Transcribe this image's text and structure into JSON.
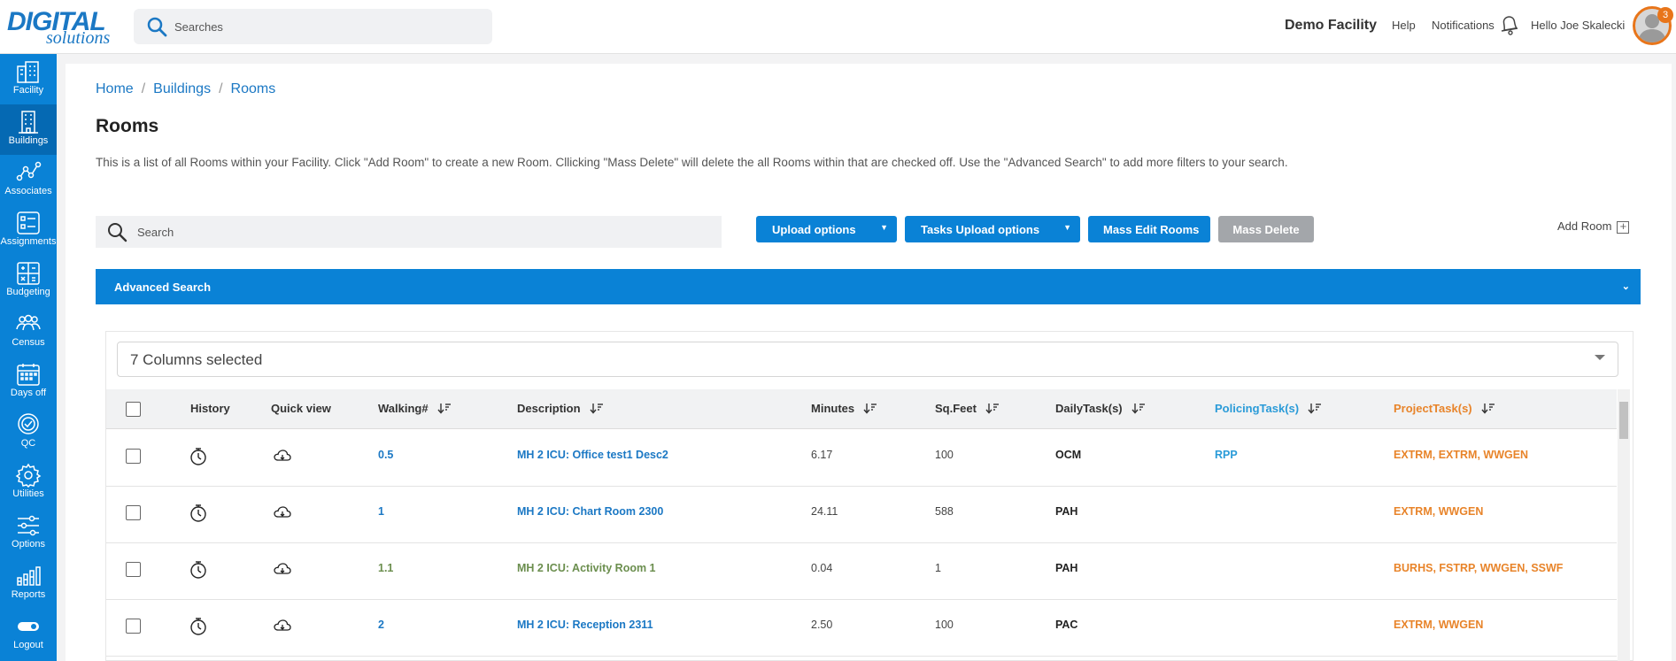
{
  "header": {
    "logo_top": "DIGITAL",
    "logo_bottom": "solutions",
    "search_placeholder": "Searches",
    "facility": "Demo Facility",
    "help": "Help",
    "notifications": "Notifications",
    "greeting": "Hello Joe Skalecki",
    "badge_count": "3"
  },
  "sidebar": {
    "items": [
      {
        "label": "Facility",
        "icon": "building-icon"
      },
      {
        "label": "Buildings",
        "icon": "office-icon"
      },
      {
        "label": "Associates",
        "icon": "network-icon"
      },
      {
        "label": "Assignments",
        "icon": "checklist-icon"
      },
      {
        "label": "Budgeting",
        "icon": "calculator-icon"
      },
      {
        "label": "Census",
        "icon": "people-icon"
      },
      {
        "label": "Days off",
        "icon": "calendar-icon"
      },
      {
        "label": "QC",
        "icon": "badge-check-icon"
      },
      {
        "label": "Utilities",
        "icon": "cog-icon"
      },
      {
        "label": "Options",
        "icon": "sliders-icon"
      },
      {
        "label": "Reports",
        "icon": "chart-icon"
      },
      {
        "label": "Logout",
        "icon": "toggle-icon"
      }
    ]
  },
  "breadcrumb": [
    "Home",
    "Buildings",
    "Rooms"
  ],
  "page": {
    "title": "Rooms",
    "description": "This is a list of all Rooms within your Facility. Click \"Add Room\" to create a new Room. Cllicking \"Mass Delete\" will delete the all Rooms within that are checked off. Use the \"Advanced Search\" to add more filters to your search."
  },
  "toolbar": {
    "search_placeholder": "Search",
    "upload_options": "Upload options",
    "tasks_upload_options": "Tasks Upload options",
    "mass_edit": "Mass Edit Rooms",
    "mass_delete": "Mass Delete",
    "add_room": "Add Room"
  },
  "advanced_search": "Advanced Search",
  "columns_selected": "7 Columns selected",
  "table": {
    "headers": {
      "history": "History",
      "quick_view": "Quick view",
      "walking": "Walking#",
      "description": "Description",
      "minutes": "Minutes",
      "sqfeet": "Sq.Feet",
      "daily": "DailyTask(s)",
      "policing": "PolicingTask(s)",
      "project": "ProjectTask(s)"
    },
    "rows": [
      {
        "walking": "0.5",
        "description": "MH 2 ICU: Office test1 Desc2",
        "minutes": "6.17",
        "sqfeet": "100",
        "daily": "OCM",
        "policing": "RPP",
        "project": "EXTRM, EXTRM, WWGEN",
        "style": "link"
      },
      {
        "walking": "1",
        "description": "MH 2 ICU: Chart Room 2300",
        "minutes": "24.11",
        "sqfeet": "588",
        "daily": "PAH",
        "policing": "",
        "project": "EXTRM, WWGEN",
        "style": "link"
      },
      {
        "walking": "1.1",
        "description": "MH 2 ICU: Activity Room 1",
        "minutes": "0.04",
        "sqfeet": "1",
        "daily": "PAH",
        "policing": "",
        "project": "BURHS, FSTRP, WWGEN, SSWF",
        "style": "green"
      },
      {
        "walking": "2",
        "description": "MH 2 ICU: Reception 2311",
        "minutes": "2.50",
        "sqfeet": "100",
        "daily": "PAC",
        "policing": "",
        "project": "EXTRM, WWGEN",
        "style": "link"
      }
    ]
  },
  "colors": {
    "primary": "#0a82d6",
    "link": "#1b78c4",
    "accent_orange": "#e8842a",
    "green": "#6b8e4e",
    "disabled": "#a3a6aa"
  }
}
